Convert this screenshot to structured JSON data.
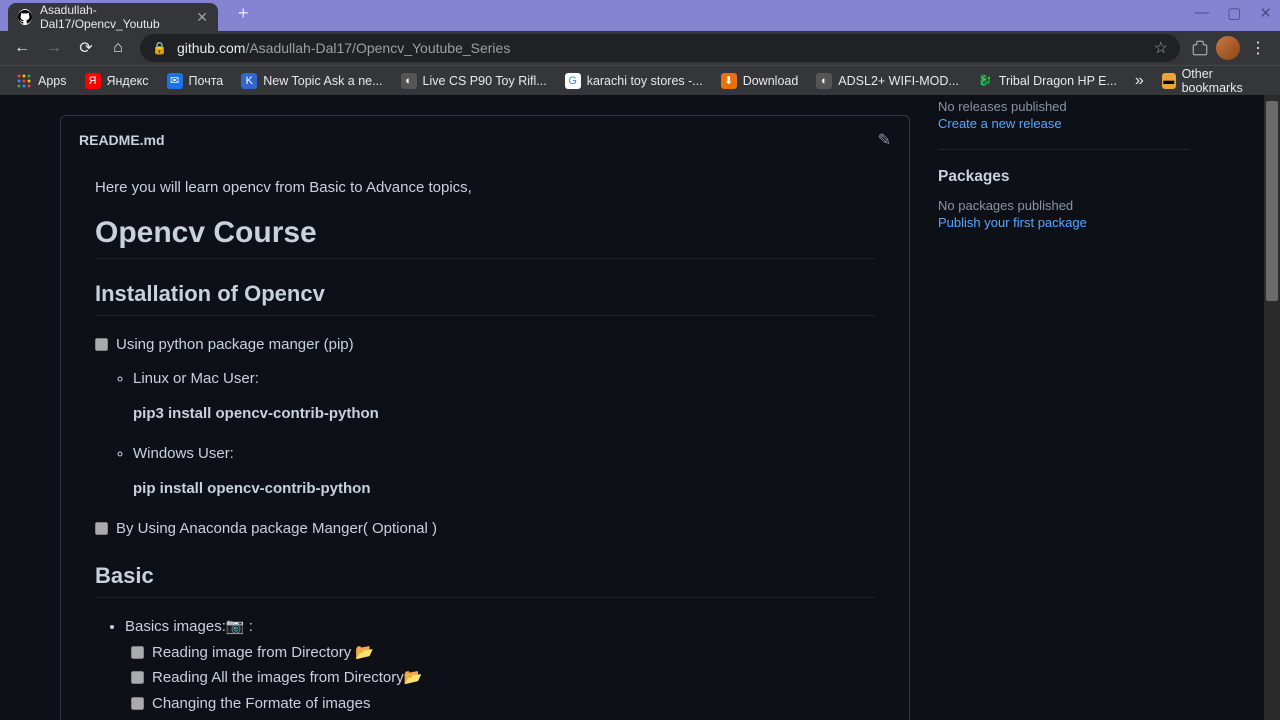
{
  "window": {
    "tab_title": "Asadullah-Dal17/Opencv_Youtub",
    "url_domain": "github.com",
    "url_path": "/Asadullah-Dal17/Opencv_Youtube_Series"
  },
  "bookmarks": {
    "apps": "Apps",
    "items": [
      {
        "label": "Яндекс",
        "icon": "Я",
        "bg": "#ff0000",
        "fg": "#fff"
      },
      {
        "label": "Почта",
        "icon": "✉",
        "bg": "#1a73e8",
        "fg": "#fff"
      },
      {
        "label": "New Topic Ask a ne...",
        "icon": "K",
        "bg": "#3366cc",
        "fg": "#fff"
      },
      {
        "label": "Live CS P90 Toy Rifl...",
        "icon": "◐",
        "bg": "#555",
        "fg": "#fff"
      },
      {
        "label": "karachi toy stores -...",
        "icon": "G",
        "bg": "#fff",
        "fg": "#4285f4"
      },
      {
        "label": "Download",
        "icon": "⬇",
        "bg": "#e8710a",
        "fg": "#fff"
      },
      {
        "label": "ADSL2+ WIFI-MOD...",
        "icon": "◐",
        "bg": "#555",
        "fg": "#fff"
      },
      {
        "label": "Tribal Dragon HP E...",
        "icon": "🐉",
        "bg": "transparent",
        "fg": "#3ddc84"
      }
    ],
    "other": "Other bookmarks"
  },
  "readme": {
    "filename": "README.md",
    "intro": "Here you will learn opencv from Basic to Advance topics,",
    "h1": "Opencv Course",
    "h2_install": "Installation of Opencv",
    "task_pip": "Using python package manger (pip)",
    "linux_label": "Linux or Mac User:",
    "linux_cmd": "pip3 install opencv-contrib-python",
    "windows_label": "Windows User:",
    "windows_cmd": "pip install opencv-contrib-python",
    "task_anaconda": "By Using Anaconda package Manger( Optional )",
    "h2_basic": "Basic",
    "basics_images": "Basics images:📷 :",
    "sub_tasks": [
      "Reading image from Directory 📂",
      "Reading All the images from Directory📂",
      "Changing the Formate of images"
    ]
  },
  "sidebar": {
    "releases_none": "No releases published",
    "releases_link": "Create a new release",
    "packages_title": "Packages",
    "packages_none": "No packages published",
    "packages_link": "Publish your first package"
  }
}
